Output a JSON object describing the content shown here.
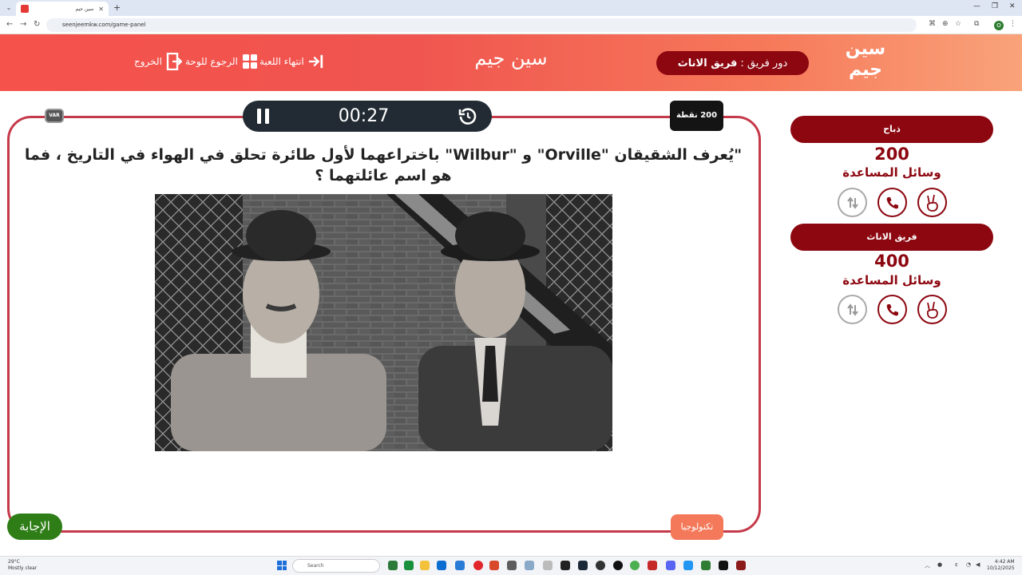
{
  "browser": {
    "tab_title": "سين جيم",
    "url": "seenjeemkw.com/game-panel",
    "profile_initial": "O"
  },
  "header": {
    "logo_line1": "سين",
    "logo_line2": "جيم",
    "turn_label": "دور فريق :",
    "turn_team": "فريق الاناث",
    "brand_title": "سين جيم",
    "nav": {
      "end_game": "انتهاء اللعبة",
      "back_to_board": "الرجوع للوحة",
      "exit": "الخروج"
    }
  },
  "teams": [
    {
      "name": "ذباح",
      "score": "200",
      "aids_label": "وسائل المساعدة"
    },
    {
      "name": "فريق الاناث",
      "score": "400",
      "aids_label": "وسائل المساعدة"
    }
  ],
  "game": {
    "timer": "00:27",
    "points": "200 نقطة",
    "var_label": "VAR",
    "question": "\"يُعرف الشقيقان \"Orville\" و \"Wilbur\" باختراعهما لأول طائرة تحلق في الهواء في التاريخ ، فما هو اسم عائلتهما ؟",
    "answer_button": "الإجابة",
    "category": "تكنولوجيا"
  },
  "taskbar": {
    "temp": "29°C",
    "weather": "Mostly clear",
    "search_placeholder": "Search",
    "time": "4:42 AM",
    "date": "10/12/2025"
  },
  "colors": {
    "primary": "#8c0710",
    "board_border": "#c53a4a",
    "header_start": "#f4524b",
    "header_end": "#f9a37a",
    "answer_green": "#2e7d16",
    "category": "#f4795a",
    "timer_bg": "#222b33"
  }
}
